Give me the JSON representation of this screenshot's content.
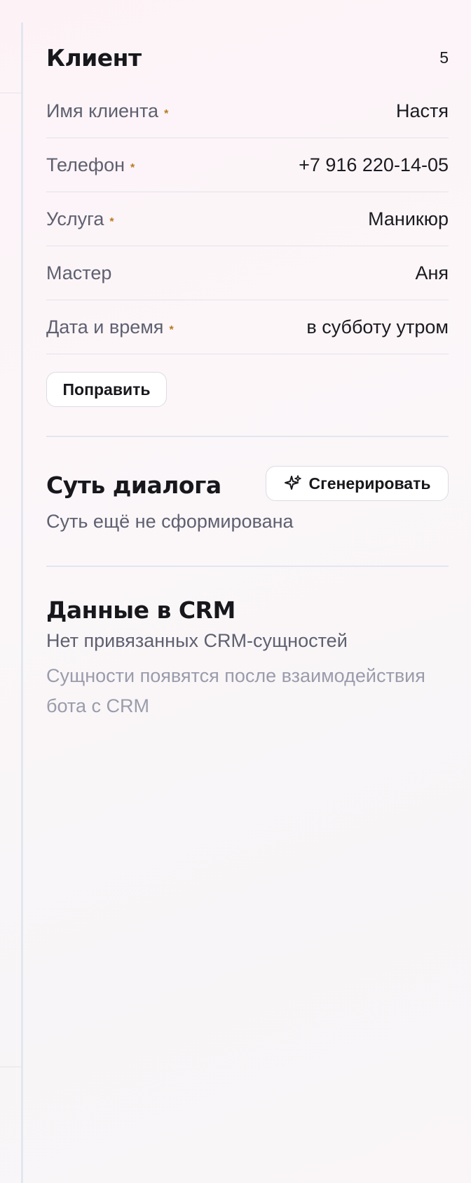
{
  "client": {
    "title": "Клиент",
    "count": "5",
    "fields": [
      {
        "label": "Имя клиента",
        "required_mark": "*",
        "value": "Настя"
      },
      {
        "label": "Телефон",
        "required_mark": "*",
        "value": "+7 916 220-14-05"
      },
      {
        "label": "Услуга",
        "required_mark": "*",
        "value": "Маникюр"
      },
      {
        "label": "Мастер",
        "required_mark": "",
        "value": "Аня"
      },
      {
        "label": "Дата и время",
        "required_mark": "*",
        "value": "в субботу утром"
      }
    ],
    "edit_button": "Поправить"
  },
  "summary": {
    "title": "Суть диалога",
    "generate_button": "Сгенерировать",
    "generate_icon": "sparkles-icon",
    "empty_text": "Суть ещё не сформирована"
  },
  "crm": {
    "title": "Данные в CRM",
    "empty_text": "Нет привязанных CRM-сущностей",
    "hint_text": "Сущности появятся после взаимодействия бота с CRM"
  },
  "colors": {
    "required_mark": "#b97a1e",
    "muted_text": "#5f6070",
    "faint_text": "#9a9cab"
  }
}
